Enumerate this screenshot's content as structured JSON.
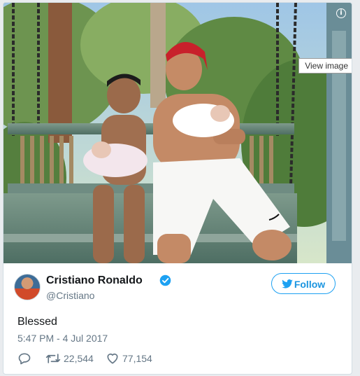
{
  "photo": {
    "alt": "Photo of a man and a boy sitting on a carved wooden swing bench, each holding a newborn baby, in a leafy garden",
    "view_image_label": "View image",
    "info_glyph": "i"
  },
  "author": {
    "name": "Cristiano Ronaldo",
    "handle": "@Cristiano",
    "verified": true
  },
  "follow_label": "Follow",
  "tweet": {
    "text": "Blessed",
    "timestamp": "5:47 PM - 4 Jul 2017"
  },
  "stats": {
    "retweets": "22,544",
    "likes": "77,154"
  },
  "colors": {
    "twitter_blue": "#1da1f2",
    "text_primary": "#14171a",
    "text_secondary": "#657786"
  }
}
